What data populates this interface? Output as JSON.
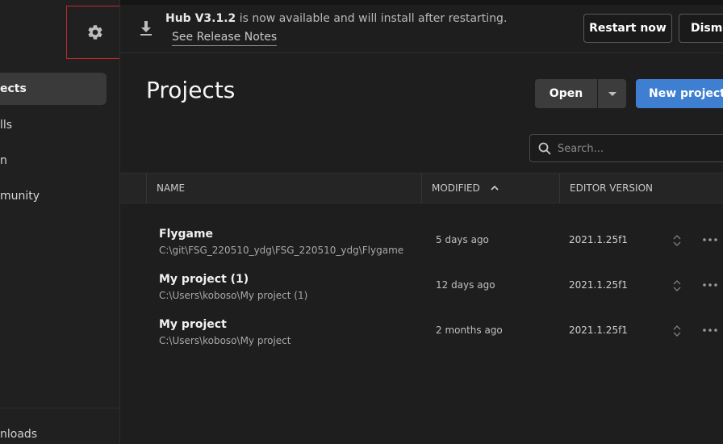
{
  "sidebar": {
    "items": [
      {
        "label": "Projects",
        "visible_label": "ects",
        "active": true
      },
      {
        "label": "Installs",
        "visible_label": "lls"
      },
      {
        "label": "Learn",
        "visible_label": "n"
      },
      {
        "label": "Community",
        "visible_label": "munity"
      }
    ],
    "footer_label": "Downloads",
    "footer_visible_label": "nloads",
    "settings_icon": "gear-icon"
  },
  "banner": {
    "version_strong": "Hub V3.1.2",
    "message": " is now available and will install after restarting.",
    "release_link": "See Release Notes",
    "restart_label": "Restart now",
    "dismiss_label": "Dismiss"
  },
  "main": {
    "title": "Projects",
    "open_label": "Open",
    "new_project_label": "New project",
    "search_placeholder": "Search..."
  },
  "table": {
    "columns": [
      "NAME",
      "MODIFIED",
      "EDITOR VERSION"
    ],
    "sort": {
      "column": "MODIFIED",
      "direction": "ascending"
    },
    "rows": [
      {
        "name": "Flygame",
        "path": "C:\\git\\FSG_220510_ydg\\FSG_220510_ydg\\Flygame",
        "modified": "5 days ago",
        "version": "2021.1.25f1"
      },
      {
        "name": "My project (1)",
        "path": "C:\\Users\\koboso\\My project (1)",
        "modified": "12 days ago",
        "version": "2021.1.25f1"
      },
      {
        "name": "My project",
        "path": "C:\\Users\\koboso\\My project",
        "modified": "2 months ago",
        "version": "2021.1.25f1"
      }
    ]
  },
  "colors": {
    "accent": "#3f7fd1",
    "highlight_box": "#c0282d",
    "background": "#1e1e1e"
  }
}
